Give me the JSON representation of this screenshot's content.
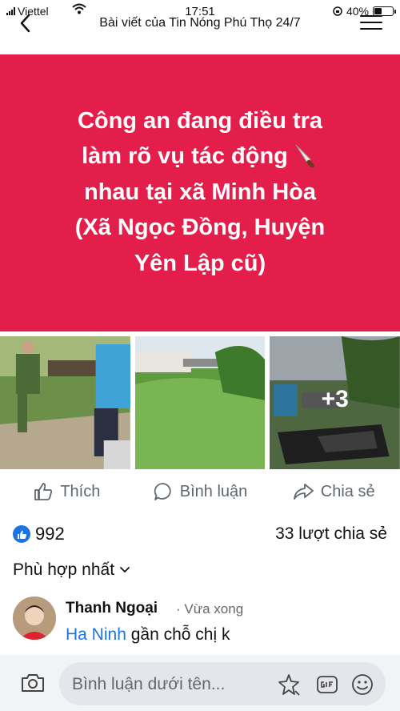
{
  "status_bar": {
    "carrier": "Viettel",
    "time": "17:51",
    "battery": "40%",
    "battery_level": 0.4
  },
  "header": {
    "title": "Bài viết của Tin Nóng Phú Thọ 24/7"
  },
  "post": {
    "headline_lines": [
      "Công an đang điều tra",
      "làm rõ vụ tác động",
      "nhau tại xã Minh Hòa",
      "(Xã Ngọc Đồng, Huyện",
      "Yên Lập cũ)"
    ],
    "headline_emoji": "knife-icon",
    "banner_color": "#e41e4a",
    "photos_more": "+3"
  },
  "actions": {
    "like": "Thích",
    "comment": "Bình luận",
    "share": "Chia sẻ"
  },
  "stats": {
    "reactions": "992",
    "shares": "33 lượt chia sẻ"
  },
  "sort": {
    "label": "Phù hợp nhất"
  },
  "comments": [
    {
      "author": "Thanh Ngoại",
      "time": "· Vừa xong",
      "mention": "Ha Ninh",
      "text": " gần chỗ chị k"
    }
  ],
  "composer": {
    "placeholder": "Bình luận dưới tên..."
  },
  "colors": {
    "accent": "#1b74e4",
    "muted": "#65676b"
  }
}
